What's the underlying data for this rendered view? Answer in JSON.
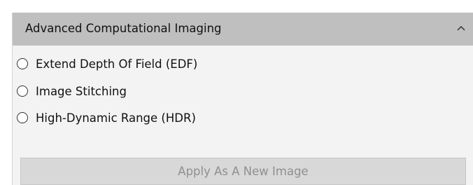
{
  "panel": {
    "title": "Advanced Computational Imaging",
    "collapse_icon": "chevron-up-icon",
    "options": [
      {
        "label": "Extend Depth Of Field (EDF)",
        "selected": false
      },
      {
        "label": "Image Stitching",
        "selected": false
      },
      {
        "label": "High-Dynamic Range (HDR)",
        "selected": false
      }
    ],
    "apply_label": "Apply As A New Image",
    "apply_enabled": false
  },
  "colors": {
    "header_bg": "#bfbfbf",
    "panel_bg": "#f3f3f3",
    "button_bg": "#d8d8d8",
    "button_text_disabled": "#8f8f8f"
  }
}
